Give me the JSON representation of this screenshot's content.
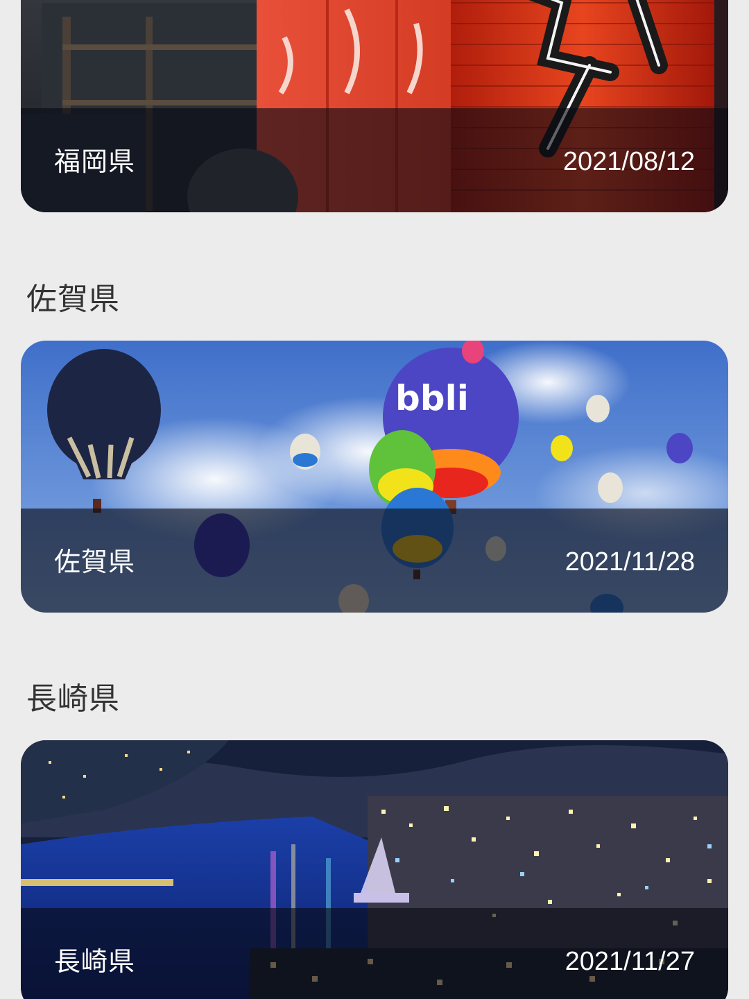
{
  "cards": [
    {
      "section_title": "",
      "name": "福岡県",
      "date": "2021/08/12",
      "image": "festival-lanterns-photo"
    },
    {
      "section_title": "佐賀県",
      "name": "佐賀県",
      "date": "2021/11/28",
      "image": "hot-air-balloons-photo"
    },
    {
      "section_title": "長崎県",
      "name": "長崎県",
      "date": "2021/11/27",
      "image": "nagasaki-night-view-photo"
    }
  ],
  "colors": {
    "background": "#ececec",
    "section_title": "#333333",
    "overlay": "rgba(8,10,20,0.62)",
    "card_text": "#ffffff"
  }
}
